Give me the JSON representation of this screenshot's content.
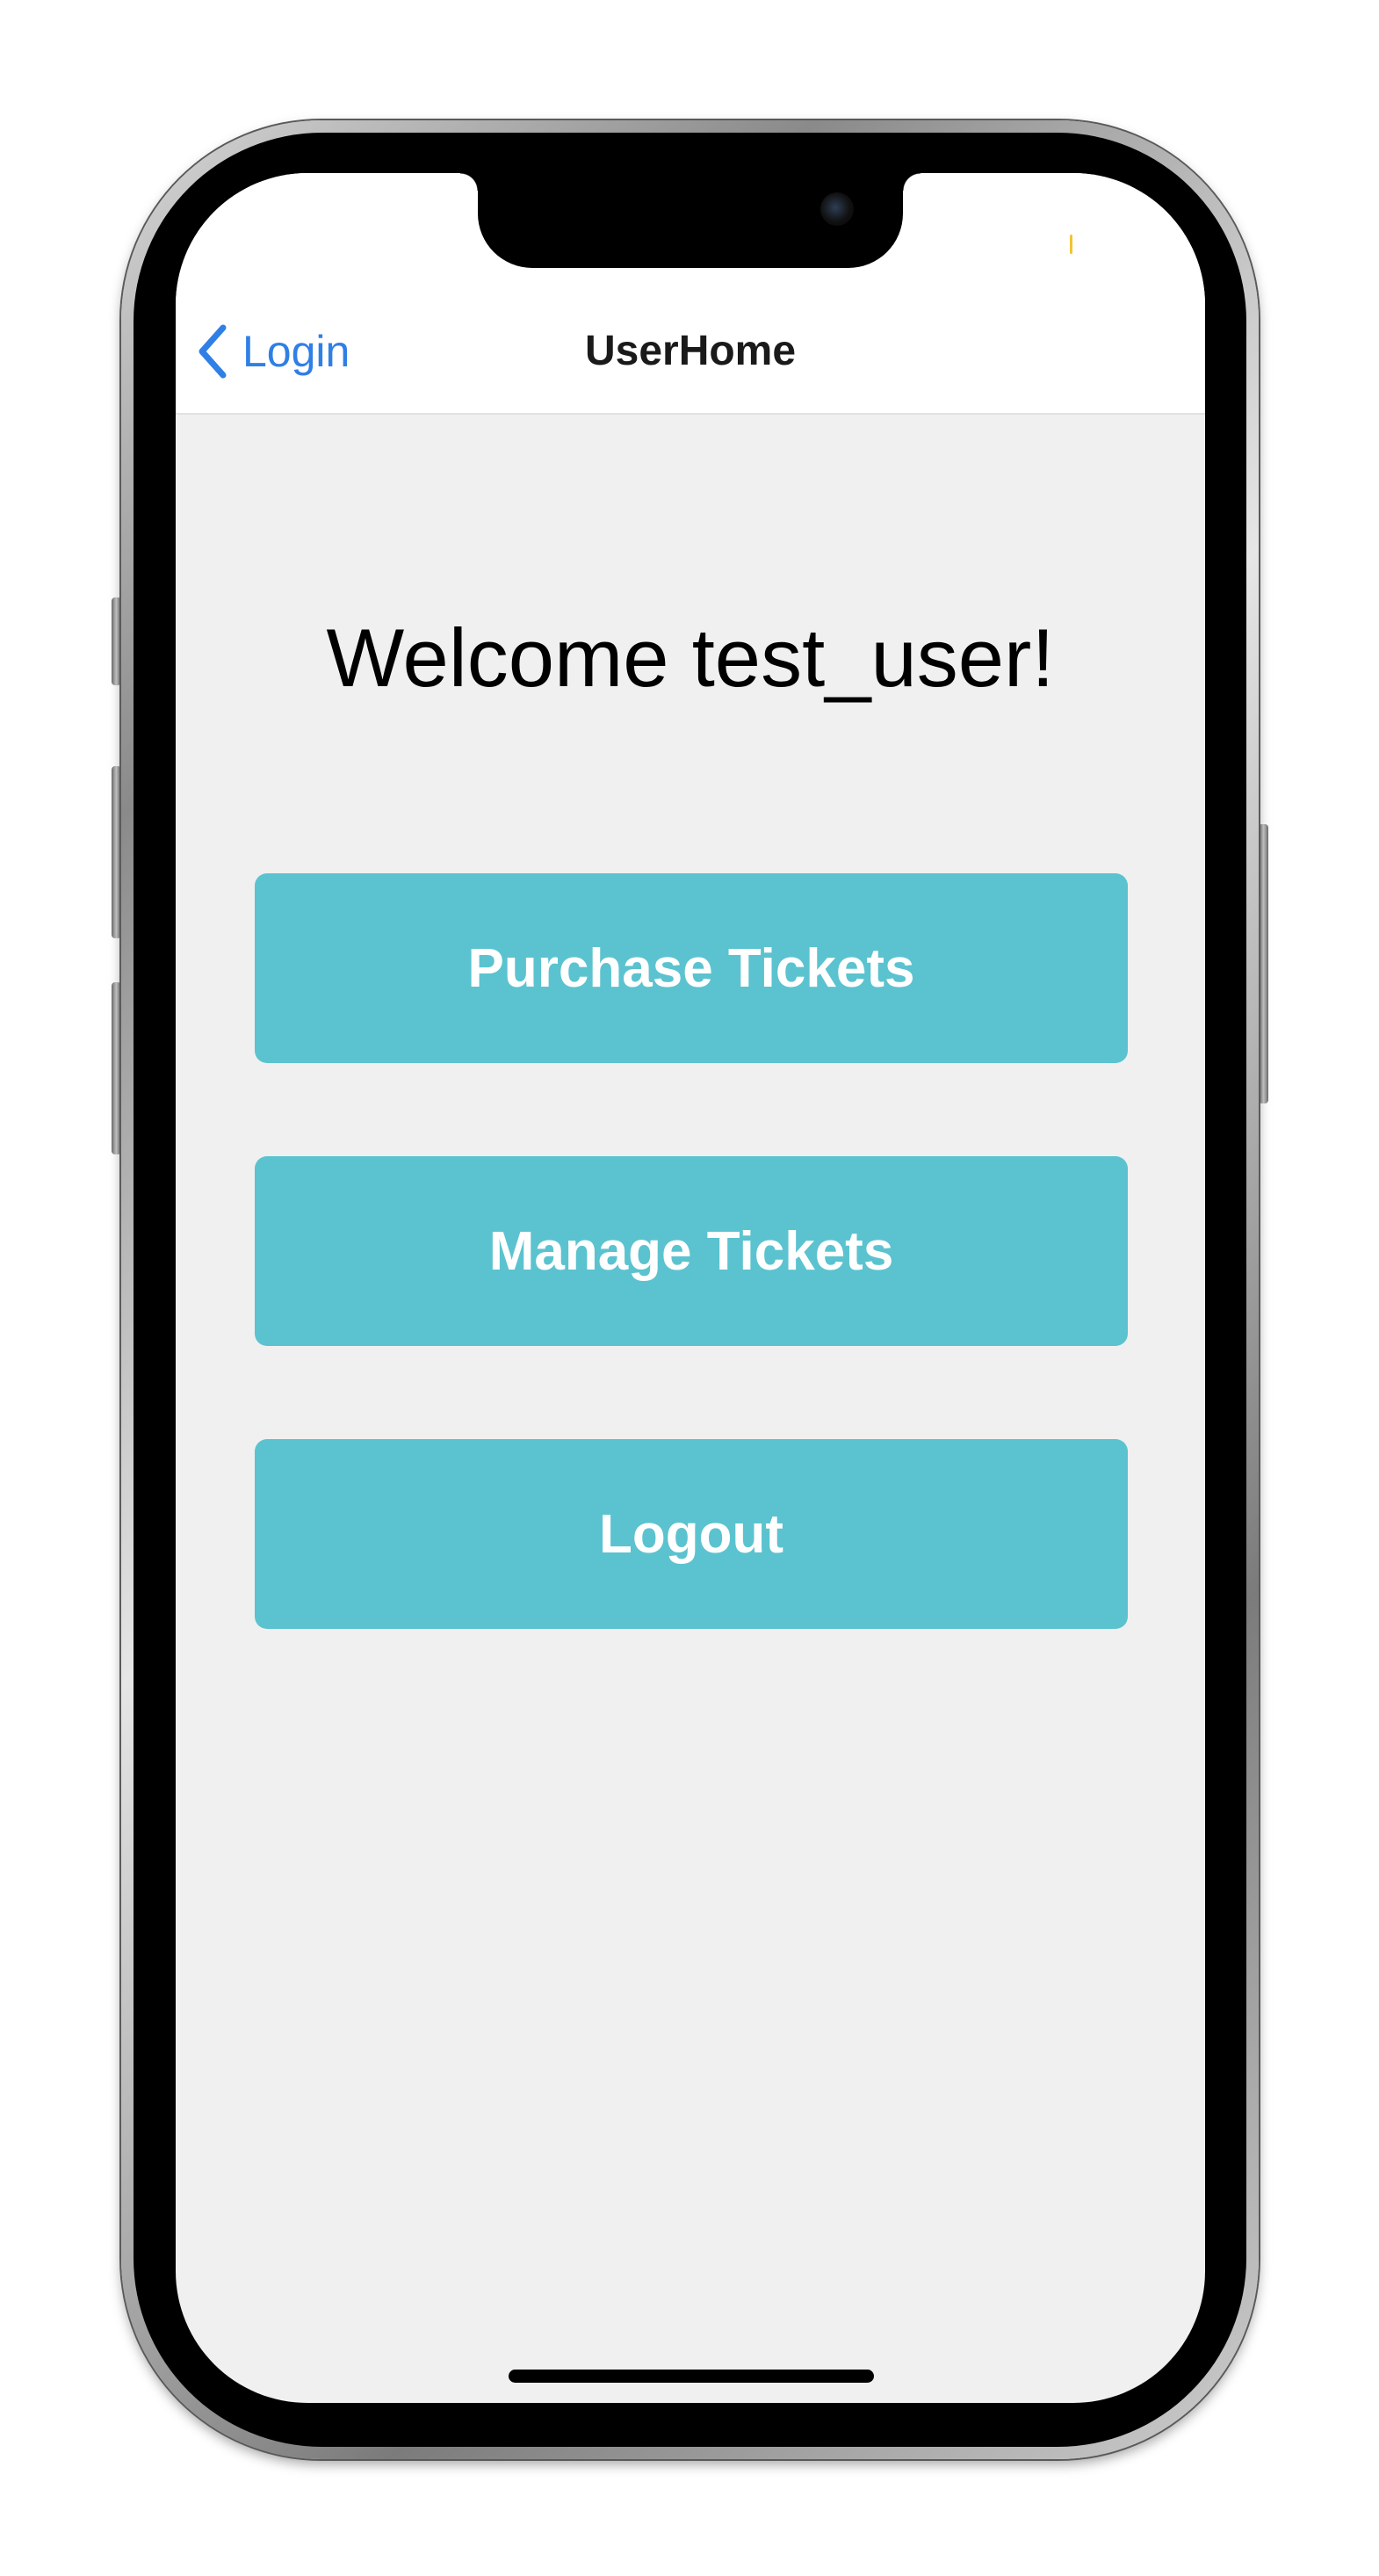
{
  "colors": {
    "accent_blue": "#2f7fe6",
    "button_teal": "#5bc3cf",
    "button_text": "#ffffff",
    "screen_background": "#f0f0f0",
    "nav_background": "#ffffff"
  },
  "nav": {
    "back_label": "Login",
    "back_icon": "chevron-left-icon",
    "title": "UserHome"
  },
  "main": {
    "welcome_text": "Welcome test_user!",
    "buttons": [
      {
        "label": "Purchase Tickets"
      },
      {
        "label": "Manage Tickets"
      },
      {
        "label": "Logout"
      }
    ]
  }
}
